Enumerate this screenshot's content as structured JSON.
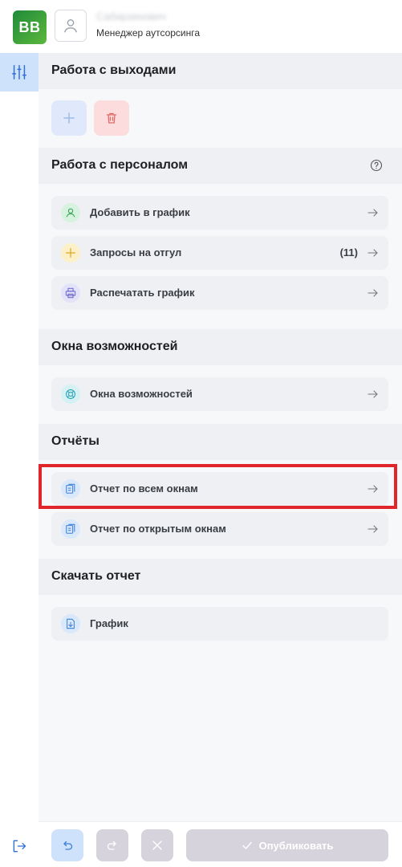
{
  "header": {
    "logo_text": "BB",
    "user_name": "Сабирзянович",
    "user_role": "Менеджер аутсорсинга"
  },
  "sections": {
    "shifts": {
      "title": "Работа с выходами"
    },
    "staff": {
      "title": "Работа с персоналом",
      "items": [
        {
          "label": "Добавить в график",
          "icon": "add-user-icon"
        },
        {
          "label": "Запросы на отгул",
          "count": "(11)",
          "icon": "plus-icon"
        },
        {
          "label": "Распечатать график",
          "icon": "print-icon"
        }
      ]
    },
    "opportunities": {
      "title": "Окна возможностей",
      "items": [
        {
          "label": "Окна возможностей",
          "icon": "lifebuoy-icon"
        }
      ]
    },
    "reports": {
      "title": "Отчёты",
      "items": [
        {
          "label": "Отчет по всем окнам",
          "icon": "report-icon"
        },
        {
          "label": "Отчет по открытым окнам",
          "icon": "report-icon"
        }
      ]
    },
    "download": {
      "title": "Скачать отчет",
      "items": [
        {
          "label": "График",
          "icon": "download-file-icon"
        }
      ]
    }
  },
  "footer": {
    "publish_label": "Опубликовать"
  },
  "colors": {
    "accent_blue": "#cfe2fb",
    "highlight_red": "#e0262b",
    "logo_green": "#2e9b3f",
    "publish_disabled": "#d6d3dc"
  }
}
